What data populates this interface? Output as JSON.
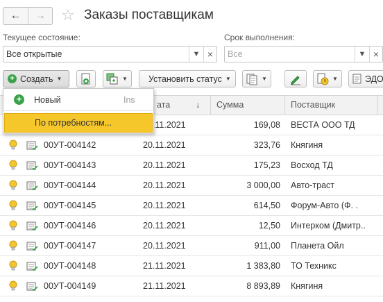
{
  "header": {
    "title": "Заказы поставщикам",
    "back_icon": "arrow-left-icon",
    "forward_icon": "arrow-right-icon",
    "favorite_icon": "star-icon"
  },
  "filters": {
    "state": {
      "label": "Текущее состояние:",
      "value": "Все открытые",
      "clear_glyph": "×"
    },
    "deadline": {
      "label": "Срок выполнения:",
      "placeholder": "Все",
      "clear_glyph": "×"
    }
  },
  "toolbar": {
    "create_label": "Создать",
    "set_status_label": "Установить статус",
    "edo_label": "ЭДО"
  },
  "create_menu": {
    "items": [
      {
        "label": "Новый",
        "shortcut": "Ins"
      },
      {
        "label": "По потребностям..."
      }
    ]
  },
  "table": {
    "columns": [
      "ата",
      "Сумма",
      "Поставщик"
    ],
    "sort_indicator": "↓",
    "rows": [
      {
        "number": "",
        "date": "20.11.2021",
        "sum": "169,08",
        "supplier": "ВЕСТА ООО ТД"
      },
      {
        "number": "00УТ-004142",
        "date": "20.11.2021",
        "sum": "323,76",
        "supplier": "Княгиня"
      },
      {
        "number": "00УТ-004143",
        "date": "20.11.2021",
        "sum": "175,23",
        "supplier": "Восход ТД"
      },
      {
        "number": "00УТ-004144",
        "date": "20.11.2021",
        "sum": "3 000,00",
        "supplier": "Авто-траст"
      },
      {
        "number": "00УТ-004145",
        "date": "20.11.2021",
        "sum": "614,50",
        "supplier": "Форум-Авто (Ф. ."
      },
      {
        "number": "00УТ-004146",
        "date": "20.11.2021",
        "sum": "12,50",
        "supplier": "Интерком (Дмитр.."
      },
      {
        "number": "00УТ-004147",
        "date": "20.11.2021",
        "sum": "911,00",
        "supplier": "Планета Ойл"
      },
      {
        "number": "00УТ-004148",
        "date": "21.11.2021",
        "sum": "1 383,80",
        "supplier": "ТО Техникс"
      },
      {
        "number": "00УТ-004149",
        "date": "21.11.2021",
        "sum": "8 893,89",
        "supplier": "Княгиня"
      }
    ]
  },
  "colors": {
    "accent_highlight": "#f5c72a",
    "bulb": "#f3c531",
    "create_green": "#3aa24b"
  }
}
